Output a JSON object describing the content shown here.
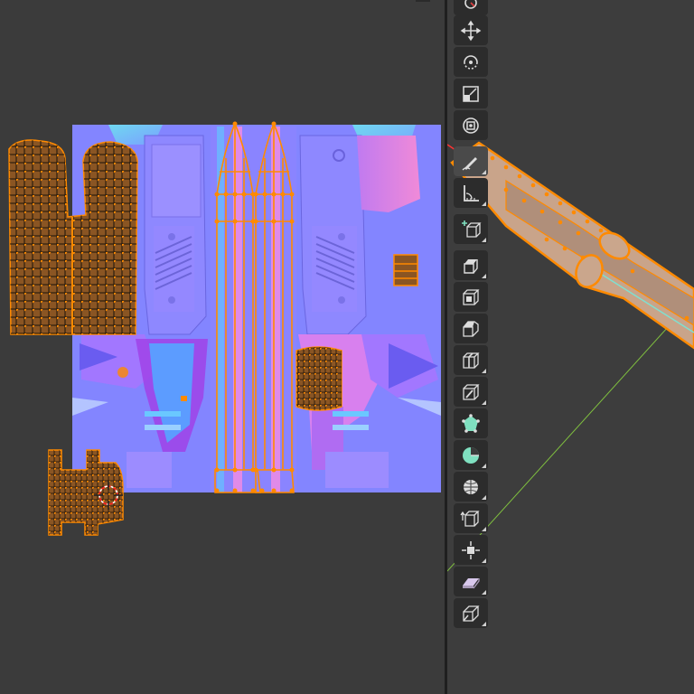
{
  "colors": {
    "editor_background": "#3b3b3b",
    "viewport_background": "#3d3d3d",
    "selection": "#ff8a00",
    "normal_map_base": "#8080ff",
    "toolbar_button": "#2c2c2c",
    "x_axis": "#ff3333",
    "y_axis": "#7fbf3f"
  },
  "uv_editor": {
    "texture": "normal-map",
    "islands": [
      "handle-grip-island",
      "barrel-island-left",
      "barrel-island-right",
      "small-ring-island",
      "cylinder-island",
      "trigger-island"
    ]
  },
  "toolbar": {
    "tools": [
      {
        "icon": "cursor-icon",
        "active": false
      },
      {
        "icon": "move-icon",
        "active": false
      },
      {
        "icon": "rotate-icon",
        "active": false
      },
      {
        "icon": "scale-icon",
        "active": false
      },
      {
        "icon": "transform-icon",
        "active": false
      },
      {
        "icon": "annotate-icon",
        "active": false
      },
      {
        "icon": "measure-icon",
        "active": false
      },
      {
        "icon": "add-cube-icon",
        "active": false
      },
      {
        "icon": "extrude-region-icon",
        "active": false
      },
      {
        "icon": "inset-faces-icon",
        "active": false
      },
      {
        "icon": "bevel-icon",
        "active": false
      },
      {
        "icon": "loop-cut-icon",
        "active": false
      },
      {
        "icon": "knife-icon",
        "active": false
      },
      {
        "icon": "poly-build-icon",
        "active": false
      },
      {
        "icon": "spin-icon",
        "active": false
      },
      {
        "icon": "smooth-icon",
        "active": false
      },
      {
        "icon": "edge-slide-icon",
        "active": false
      },
      {
        "icon": "shrink-fatten-icon",
        "active": false
      },
      {
        "icon": "shear-icon",
        "active": false
      },
      {
        "icon": "rip-region-icon",
        "active": false
      }
    ]
  }
}
